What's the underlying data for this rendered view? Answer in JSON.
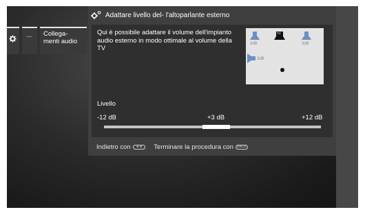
{
  "breadcrumb": {
    "ellipsis": "...",
    "current": "Collega-\nmenti audio"
  },
  "panel": {
    "title": "Adattare livello del- l'altoparlante esterno",
    "description": "Qui è possibile adattare il volume dell'impianto audio esterno in modo ottimale al volume della TV"
  },
  "diagram": {
    "tv_label": "TV",
    "left_db": "3dB",
    "right_db": "3dB",
    "side_db": "3dB"
  },
  "level": {
    "label": "Livello",
    "min_label": "-12 dB",
    "mid_label": "+3 dB",
    "max_label": "+12 dB",
    "value_db": 3
  },
  "footer": {
    "back_text": "Indietro con",
    "back_key": "◄◄",
    "end_text": "Terminare la procedura con",
    "end_key": "BACK"
  },
  "colors": {
    "panel": "#3f3f3f",
    "panel_body": "#2f2f2f",
    "speaker_blue": "#6d8fc4",
    "track": "#c4c4c4",
    "thumb": "#ffffff"
  },
  "icons": [
    "gear-icon",
    "settings-gear-icon",
    "speaker-icon",
    "tv-icon",
    "listener-dot-icon",
    "rewind-key-icon",
    "back-key-icon"
  ]
}
